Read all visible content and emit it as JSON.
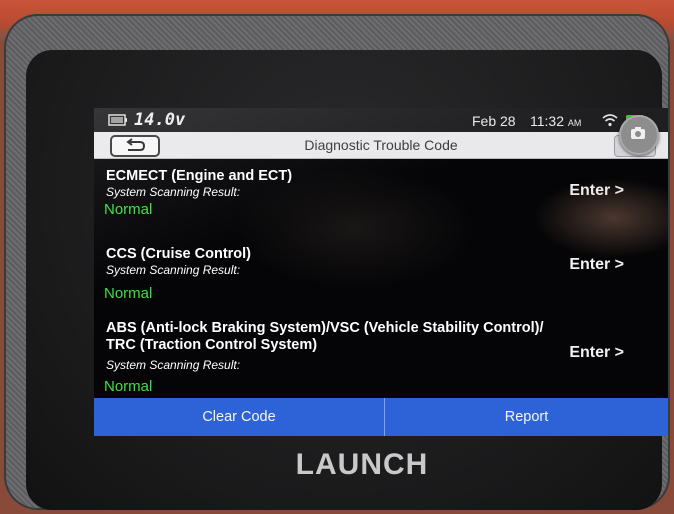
{
  "device": {
    "brand": "LAUNCH"
  },
  "status_bar": {
    "voltage": "14.0v",
    "date": "Feb 28",
    "time": "11:32",
    "time_suffix": "AM"
  },
  "header": {
    "title": "Diagnostic Trouble Code"
  },
  "systems": [
    {
      "name": "ECMECT (Engine and ECT)",
      "result_label": "System Scanning Result:",
      "status": "Normal",
      "action": "Enter >"
    },
    {
      "name": "CCS (Cruise Control)",
      "result_label": "System Scanning Result:",
      "status": "Normal",
      "action": "Enter >"
    },
    {
      "name": "ABS (Anti-lock Braking System)/VSC (Vehicle Stability Control)/ TRC (Traction Control System)",
      "result_label": "System Scanning Result:",
      "status": "Normal",
      "action": "Enter >"
    }
  ],
  "footer": {
    "clear_label": "Clear Code",
    "report_label": "Report"
  },
  "colors": {
    "accent_blue": "#2e63d8",
    "status_normal": "#39e13c",
    "battery_green": "#3bd13b"
  },
  "icons": [
    "battery-icon",
    "wifi-icon",
    "back-arrow-icon",
    "help-icon",
    "camera-icon"
  ]
}
